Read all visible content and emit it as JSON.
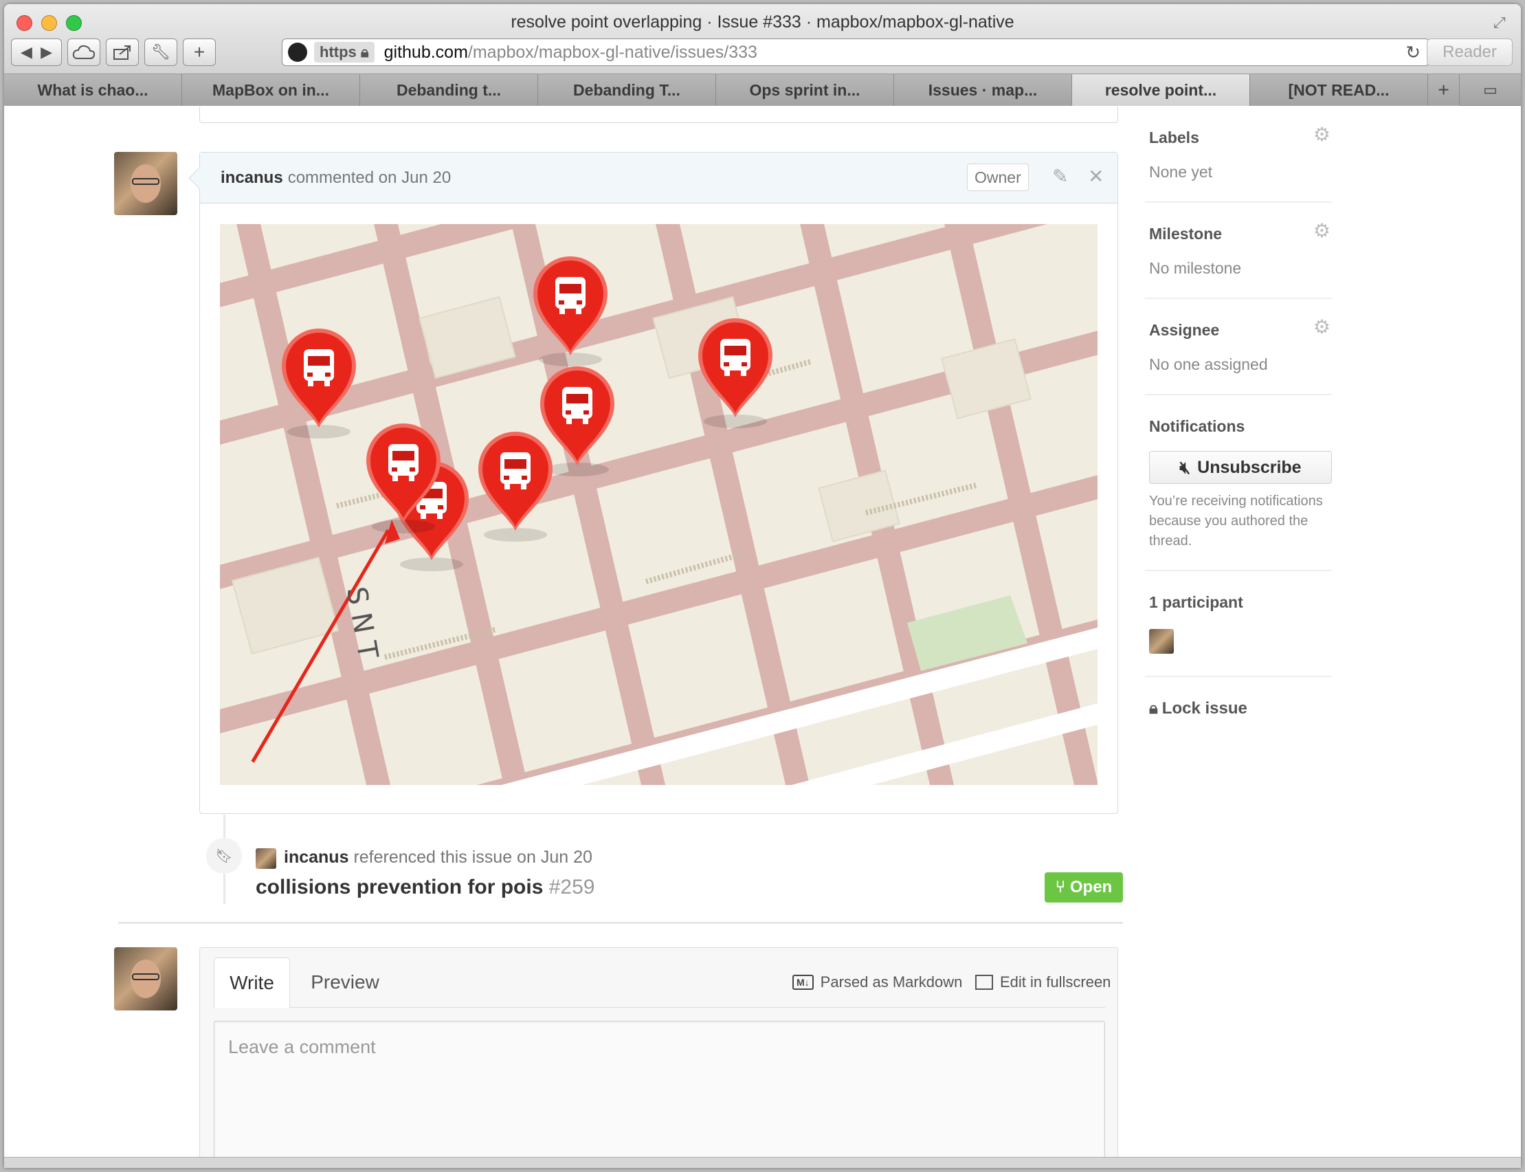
{
  "window": {
    "title": "resolve point overlapping · Issue #333 · mapbox/mapbox-gl-native"
  },
  "toolbar": {
    "url_scheme": "https",
    "url_host": "github.com",
    "url_path": "/mapbox/mapbox-gl-native/issues/333",
    "reader_label": "Reader"
  },
  "tabs": [
    {
      "label": "What is chao..."
    },
    {
      "label": "MapBox on in..."
    },
    {
      "label": "Debanding t..."
    },
    {
      "label": "Debanding T..."
    },
    {
      "label": "Ops sprint in..."
    },
    {
      "label": "Issues · map..."
    },
    {
      "label": "resolve point...",
      "active": true
    },
    {
      "label": "[NOT READ..."
    }
  ],
  "comment": {
    "author": "incanus",
    "action": "commented on Jun 20",
    "badge": "Owner"
  },
  "map_labels": {
    "street": "S N T"
  },
  "reference": {
    "author": "incanus",
    "action": "referenced this issue on Jun 20",
    "title": "collisions prevention for pois",
    "number": "#259",
    "status": "Open"
  },
  "new_comment": {
    "tab_write": "Write",
    "tab_preview": "Preview",
    "markdown_label": "Parsed as Markdown",
    "fullscreen_label": "Edit in fullscreen",
    "placeholder": "Leave a comment"
  },
  "sidebar": {
    "labels_title": "Labels",
    "labels_value": "None yet",
    "milestone_title": "Milestone",
    "milestone_value": "No milestone",
    "assignee_title": "Assignee",
    "assignee_value": "No one assigned",
    "notifications_title": "Notifications",
    "unsubscribe_label": "Unsubscribe",
    "notifications_text": "You’re receiving notifications because you authored the thread.",
    "participants_title": "1 participant",
    "lock_label": "Lock issue"
  },
  "colors": {
    "accent_open": "#6cc644",
    "marker_red": "#e8251b",
    "road": "#d9b3ad",
    "land": "#f1ece0"
  },
  "icons": [
    "back-icon",
    "forward-icon",
    "icloud-icon",
    "share-icon",
    "wrench-icon",
    "add-icon",
    "github-icon",
    "lock-icon",
    "reload-icon",
    "gear-icon",
    "pencil-icon",
    "close-icon",
    "bookmark-icon",
    "pull-request-icon",
    "markdown-icon",
    "fullscreen-icon",
    "mute-icon",
    "bus-icon"
  ]
}
